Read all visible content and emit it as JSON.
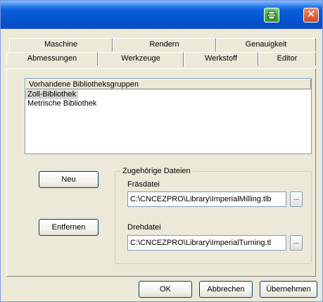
{
  "tabs_back": [
    "Maschine",
    "Rendern",
    "Genauigkeit"
  ],
  "tabs_front": [
    "Abmessungen",
    "Werkzeuge",
    "Werkstoff",
    "Editor"
  ],
  "active_tab": "Werkzeuge",
  "library_list": {
    "header": "Vorhandene Bibliotheksgruppen",
    "items": [
      "Zoll-Bibliothek",
      "Metrische Bibliothek"
    ],
    "selected": "Zoll-Bibliothek"
  },
  "buttons": {
    "new": "Neu",
    "remove": "Entfernen"
  },
  "files_group": {
    "legend": "Zugehörige Dateien",
    "milling_label": "Fräsdatei",
    "milling_value": "C:\\CNCEZPRO\\Library\\ImperialMilling.tlb",
    "turning_label": "Drehdatei",
    "turning_value": "C:\\CNCEZPRO\\Library\\ImperialTurning.tl",
    "browse": "..."
  },
  "footer": {
    "ok": "OK",
    "cancel": "Abbrechen",
    "apply": "Übernehmen"
  },
  "titlebar": {
    "close_glyph": "✕"
  },
  "colors": {
    "titlebar": "#0552d0",
    "dialog_bg": "#ece9d8",
    "close_button": "#d2461f",
    "green_button": "#2a9d2a"
  }
}
